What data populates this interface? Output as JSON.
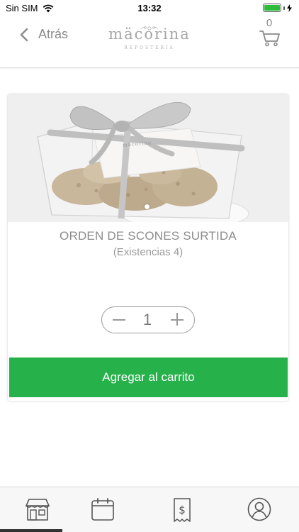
{
  "status_bar": {
    "carrier": "Sin SIM",
    "time": "13:32",
    "icons": [
      "wifi-icon",
      "battery-icon",
      "charging-bolt-icon"
    ]
  },
  "header": {
    "back_label": "Atrás",
    "logo_name": "mäcorina",
    "logo_subtitle": "REPOSTERÍA",
    "cart_count": "0"
  },
  "product": {
    "title": "ORDEN DE SCONES SURTIDA",
    "stock": "(Existencias 4)",
    "quantity": "1",
    "image_label": "mäcorina",
    "image_pages": 1,
    "current_image": 1
  },
  "actions": {
    "add_to_cart": "Agregar al carrito"
  },
  "tabs": [
    {
      "icon": "store-icon",
      "active": true
    },
    {
      "icon": "calendar-icon",
      "active": false
    },
    {
      "icon": "receipt-icon",
      "active": false
    },
    {
      "icon": "user-icon",
      "active": false
    }
  ],
  "colors": {
    "accent_green": "#26b14a",
    "battery_green": "#2ebd3b",
    "muted_text": "#8c8c8c"
  }
}
